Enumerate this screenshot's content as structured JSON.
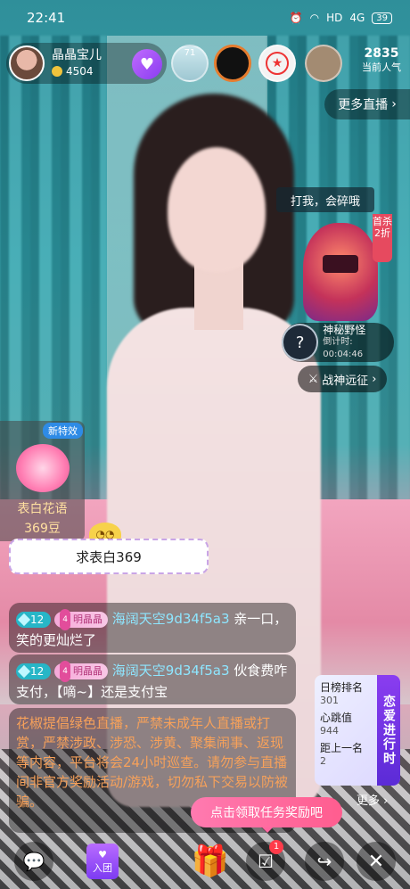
{
  "status_bar": {
    "time": "22:41",
    "network": "HD",
    "signal": "4G",
    "battery": "39"
  },
  "host": {
    "name": "晶晶宝儿",
    "fans": "4504"
  },
  "top_viewers": {
    "first_count": "71"
  },
  "popularity": {
    "value": "2835",
    "label": "当前人气"
  },
  "more_live": "更多直播",
  "event": {
    "tip": "打我，会碎哦",
    "discount": "首杀2折",
    "mystery_name": "神秘野怪",
    "countdown": "倒计时: 00:04:46",
    "war_label": "战神远征"
  },
  "flower": {
    "tag": "新特效",
    "name": "表白花语",
    "price": "369豆"
  },
  "confess_text": "求表白369",
  "messages": [
    {
      "level": "12",
      "fan_level": "4",
      "fan_name": "明晶晶",
      "user": "海阔天空9d34f5a3",
      "text": "亲一口，笑的更灿烂了"
    },
    {
      "level": "12",
      "fan_level": "4",
      "fan_name": "明晶晶",
      "user": "海阔天空9d34f5a3",
      "text": "伙食费咋支付，【嘀~】还是支付宝"
    }
  ],
  "notice": "花椒提倡绿色直播，严禁未成年人直播或打赏，严禁涉政、涉恐、涉黄、聚集闹事、返现等内容，平台将会24小时巡查。请勿参与直播间非官方奖励活动/游戏，切勿私下交易以防被骗。",
  "rank": {
    "day_rank_label": "日榜排名",
    "day_rank": "301",
    "heartbeat_label": "心跳值",
    "heartbeat": "944",
    "gap_label": "距上一名",
    "gap": "2",
    "side": "恋爱进行时"
  },
  "more_label": "更多",
  "task_prompt": "点击领取任务奖励吧",
  "toolbar": {
    "join_label": "入团",
    "task_badge": "1"
  },
  "icons": [
    "chat-icon",
    "join-group-icon",
    "gift-icon",
    "task-icon",
    "share-icon",
    "close-icon"
  ]
}
